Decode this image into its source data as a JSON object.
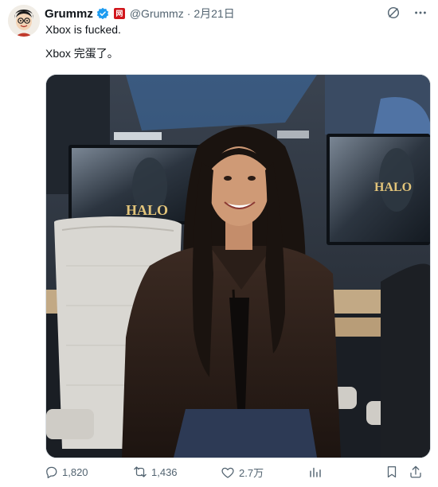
{
  "author": {
    "display_name": "Grummz",
    "handle": "@Grummz",
    "separator": "·",
    "date": "2月21日",
    "affiliate_badge": "网"
  },
  "tweet": {
    "line1": "Xbox is fucked.",
    "line2": "Xbox 完蛋了。"
  },
  "photo": {
    "monitor_left_text": "HALO",
    "monitor_right_text": "HALO"
  },
  "actions": {
    "replies": "1,820",
    "retweets": "1,436",
    "likes": "2.7万",
    "views": ""
  },
  "icons": [
    "avatar",
    "verified-badge-icon",
    "grok-icon",
    "more-options-icon",
    "reply-icon",
    "retweet-icon",
    "like-icon",
    "views-icon",
    "bookmark-icon",
    "share-icon"
  ],
  "colors": {
    "text": "#0f1419",
    "muted": "#536471",
    "verified": "#1d9bf0",
    "affiliate": "#d1161c"
  }
}
